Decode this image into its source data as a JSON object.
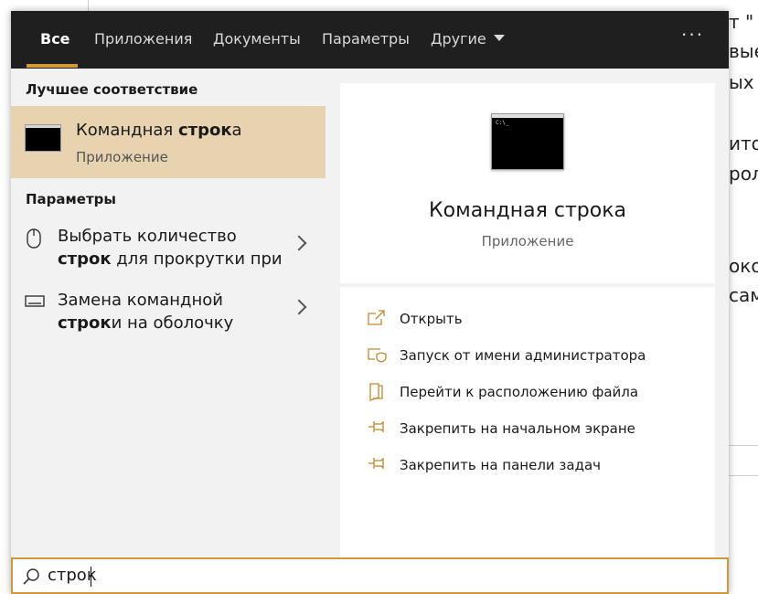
{
  "background": {
    "lines": [
      "т \"",
      "вые",
      "ых в",
      "ито",
      "рол",
      "око",
      "сам"
    ]
  },
  "tabs": [
    {
      "label": "Все"
    },
    {
      "label": "Приложения"
    },
    {
      "label": "Документы"
    },
    {
      "label": "Параметры"
    },
    {
      "label": "Другие"
    }
  ],
  "more_label": "···",
  "best_match": {
    "section_title": "Лучшее соответствие",
    "title_pre": "Командная ",
    "title_bold": "строк",
    "title_post": "а",
    "subtitle": "Приложение"
  },
  "settings": {
    "section_title": "Параметры",
    "items": [
      {
        "line1": "Выбрать количество",
        "bold": "строк",
        "rest": " для прокрутки при",
        "icon": "mouse-icon"
      },
      {
        "line1": "Замена командной",
        "bold": "строк",
        "rest": "и на оболочку",
        "icon": "keyboard-icon"
      }
    ]
  },
  "preview": {
    "thumb_text": "C:\\_",
    "title": "Командная строка",
    "subtitle": "Приложение"
  },
  "actions": [
    {
      "label": "Открыть",
      "icon": "open-icon"
    },
    {
      "label": "Запуск от имени администратора",
      "icon": "run-as-admin-icon"
    },
    {
      "label": "Перейти к расположению файла",
      "icon": "file-location-icon"
    },
    {
      "label": "Закрепить на начальном экране",
      "icon": "pin-start-icon"
    },
    {
      "label": "Закрепить на панели задач",
      "icon": "pin-taskbar-icon"
    }
  ],
  "search": {
    "value": "строк"
  },
  "colors": {
    "accent": "#d3983a",
    "selection": "#e8d3b0",
    "topbar": "#1f1f1f"
  }
}
